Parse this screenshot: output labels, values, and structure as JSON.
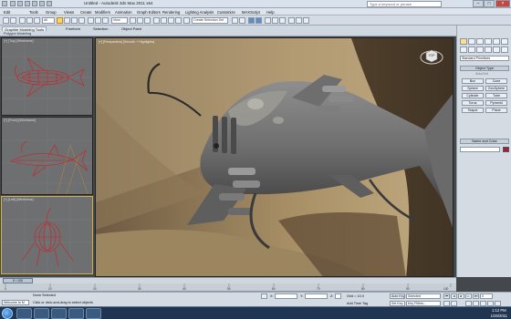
{
  "window": {
    "title": "Untitled    - Autodesk 3ds Max 2011 x64",
    "search_placeholder": "Type a keyword or phrase"
  },
  "menu": [
    "Edit",
    "Tools",
    "Group",
    "Views",
    "Create",
    "Modifiers",
    "Animation",
    "Graph Editors",
    "Rendering",
    "Lighting Analysis",
    "Customize",
    "MAXScript",
    "Help"
  ],
  "toolbar": {
    "filter_value": "All",
    "view_value": "View",
    "selection_set": "Create Selection Set"
  },
  "ribbon": {
    "tabs": [
      "Graphite Modeling Tools",
      "Freeform",
      "Selection",
      "Object Paint"
    ],
    "sub_label": "Polygon Modeling"
  },
  "viewports": {
    "top_label": "[+] [Top] [Wireframe]",
    "front_label": "[+] [Front] [Wireframe]",
    "left_label": "[+] [Left] [Wireframe]",
    "persp_label": "[+] [Perspective] [Smooth + Highlights]",
    "viewcube_label": "TOP"
  },
  "command_panel": {
    "category": "Standard Primitives",
    "rollout_object_type": "Object Type",
    "autogrid": "AutoGrid",
    "primitives": [
      "Box",
      "Cone",
      "Sphere",
      "GeoSphere",
      "Cylinder",
      "Tube",
      "Torus",
      "Pyramid",
      "Teapot",
      "Plane"
    ],
    "rollout_name_color": "Name and Color",
    "object_color": "#a61e3a"
  },
  "timeline": {
    "frame_display": "0 / 100",
    "ticks": [
      "0",
      "10",
      "20",
      "30",
      "40",
      "50",
      "60",
      "70",
      "80",
      "90",
      "100"
    ]
  },
  "status": {
    "maxscript_label": "Welcome to M",
    "selection": "None Selected",
    "prompt": "Click or click-and-drag to select objects",
    "x_label": "X:",
    "y_label": "Y:",
    "z_label": "Z:",
    "grid": "Grid = 10.0",
    "add_time_tag": "Add Time Tag",
    "auto_key": "Auto Key",
    "set_key": "Set Key",
    "key_mode": "Selected",
    "key_filters": "Key Filters...",
    "current_frame": "0"
  },
  "taskbar": {
    "time": "1:12 PM",
    "date": "1/26/2011"
  }
}
